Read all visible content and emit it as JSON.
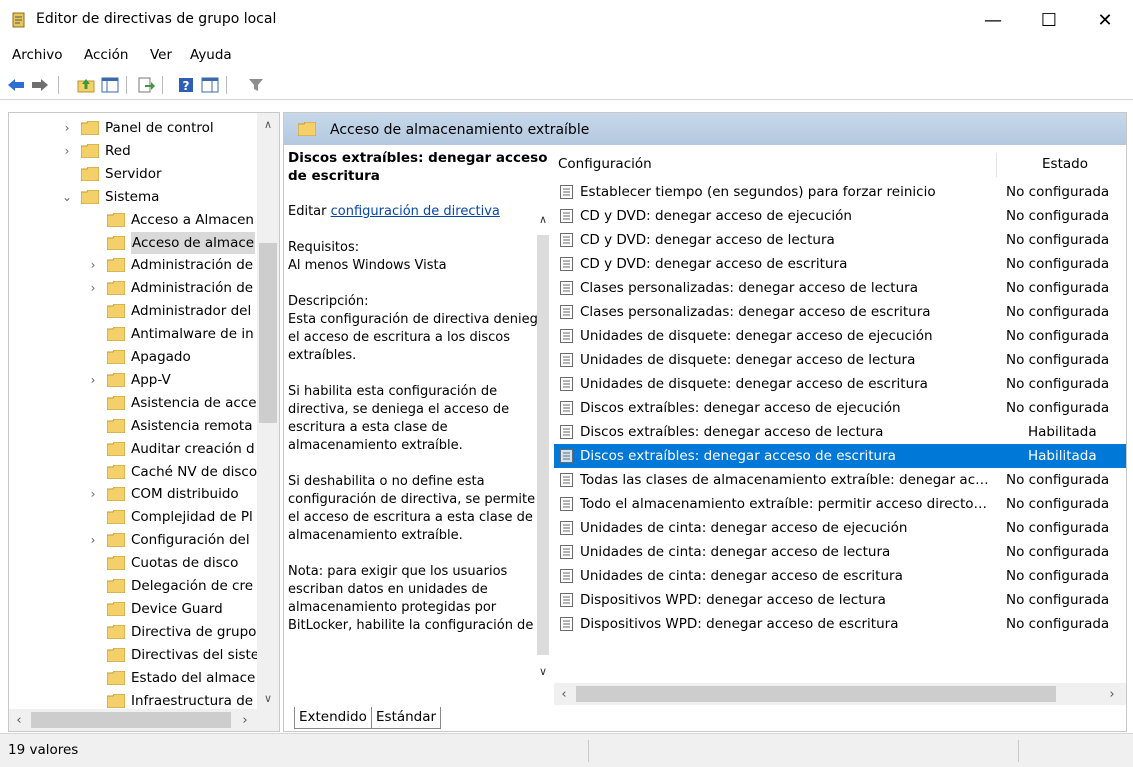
{
  "window": {
    "title": "Editor de directivas de grupo local",
    "minimize": "—",
    "maximize": "☐",
    "close": "✕"
  },
  "menu": [
    "Archivo",
    "Acción",
    "Ver",
    "Ayuda"
  ],
  "toolbar_icons": [
    "back-arrow-icon",
    "forward-arrow-icon",
    "up-folder-icon",
    "show-hide-tree-icon",
    "export-list-icon",
    "help-icon",
    "properties-icon",
    "filter-icon"
  ],
  "tree": {
    "items": [
      {
        "label": "Panel de control",
        "expander": "›"
      },
      {
        "label": "Red",
        "expander": "›"
      },
      {
        "label": "Servidor",
        "expander": ""
      },
      {
        "label": "Sistema",
        "expander": "⌄"
      },
      {
        "label": "Acceso a Almacen",
        "expander": ""
      },
      {
        "label": "Acceso de almace",
        "expander": "",
        "selected": true
      },
      {
        "label": "Administración de",
        "expander": "›"
      },
      {
        "label": "Administración de",
        "expander": "›"
      },
      {
        "label": "Administrador del",
        "expander": ""
      },
      {
        "label": "Antimalware de in",
        "expander": ""
      },
      {
        "label": "Apagado",
        "expander": ""
      },
      {
        "label": "App-V",
        "expander": "›"
      },
      {
        "label": "Asistencia de acce",
        "expander": ""
      },
      {
        "label": "Asistencia remota",
        "expander": ""
      },
      {
        "label": "Auditar creación d",
        "expander": ""
      },
      {
        "label": "Caché NV de disco",
        "expander": ""
      },
      {
        "label": "COM distribuido",
        "expander": "›"
      },
      {
        "label": "Complejidad de Pl",
        "expander": ""
      },
      {
        "label": "Configuración del",
        "expander": "›"
      },
      {
        "label": "Cuotas de disco",
        "expander": ""
      },
      {
        "label": "Delegación de cre",
        "expander": ""
      },
      {
        "label": "Device Guard",
        "expander": ""
      },
      {
        "label": "Directiva de grupo",
        "expander": ""
      },
      {
        "label": "Directivas del siste",
        "expander": ""
      },
      {
        "label": "Estado del almace",
        "expander": ""
      },
      {
        "label": "Infraestructura de",
        "expander": ""
      }
    ]
  },
  "header": {
    "title": "Acceso de almacenamiento extraíble"
  },
  "description": {
    "title": "Discos extraíbles: denegar acceso de escritura",
    "edit_prefix": "Editar ",
    "edit_link": "configuración de directiva",
    "req_label": "Requisitos:",
    "req_value": "Al menos Windows Vista",
    "desc_label": "Descripción:",
    "p1": "Esta configuración de directiva deniega el acceso de escritura a los discos extraíbles.",
    "p2": "Si habilita esta configuración de directiva, se deniega el acceso de escritura a esta clase de almacenamiento extraíble.",
    "p3": "Si deshabilita o no define esta configuración de directiva, se permite el acceso de escritura a esta clase de almacenamiento extraíble.",
    "p4": "Nota: para exigir que los usuarios escriban datos en unidades de almacenamiento protegidas por BitLocker, habilite la configuración de"
  },
  "list": {
    "col_name": "Configuración",
    "col_state": "Estado",
    "rows": [
      {
        "name": "Establecer tiempo (en segundos) para forzar reinicio",
        "state": "No configurada"
      },
      {
        "name": "CD y DVD: denegar acceso de ejecución",
        "state": "No configurada"
      },
      {
        "name": "CD y DVD: denegar acceso de lectura",
        "state": "No configurada"
      },
      {
        "name": "CD y DVD: denegar acceso de escritura",
        "state": "No configurada"
      },
      {
        "name": "Clases personalizadas: denegar acceso de lectura",
        "state": "No configurada"
      },
      {
        "name": "Clases personalizadas: denegar acceso de escritura",
        "state": "No configurada"
      },
      {
        "name": "Unidades de disquete: denegar acceso de ejecución",
        "state": "No configurada"
      },
      {
        "name": "Unidades de disquete: denegar acceso de lectura",
        "state": "No configurada"
      },
      {
        "name": "Unidades de disquete: denegar acceso de escritura",
        "state": "No configurada"
      },
      {
        "name": "Discos extraíbles: denegar acceso de ejecución",
        "state": "No configurada"
      },
      {
        "name": "Discos extraíbles: denegar acceso de lectura",
        "state": "Habilitada"
      },
      {
        "name": "Discos extraíbles: denegar acceso de escritura",
        "state": "Habilitada",
        "selected": true
      },
      {
        "name": "Todas las clases de almacenamiento extraíble: denegar acce...",
        "state": "No configurada"
      },
      {
        "name": "Todo el almacenamiento extraíble: permitir acceso directo e...",
        "state": "No configurada"
      },
      {
        "name": "Unidades de cinta: denegar acceso de ejecución",
        "state": "No configurada"
      },
      {
        "name": "Unidades de cinta: denegar acceso de lectura",
        "state": "No configurada"
      },
      {
        "name": "Unidades de cinta: denegar acceso de escritura",
        "state": "No configurada"
      },
      {
        "name": "Dispositivos WPD: denegar acceso de lectura",
        "state": "No configurada"
      },
      {
        "name": "Dispositivos WPD: denegar acceso de escritura",
        "state": "No configurada"
      }
    ]
  },
  "tabs": {
    "extended": "Extendido",
    "standard": "Estándar"
  },
  "status": {
    "text": "19 valores"
  },
  "colors": {
    "selection": "#0078d7",
    "header_band": "#b8cce0",
    "folder": "#f4d06b",
    "link": "#0645ad"
  }
}
